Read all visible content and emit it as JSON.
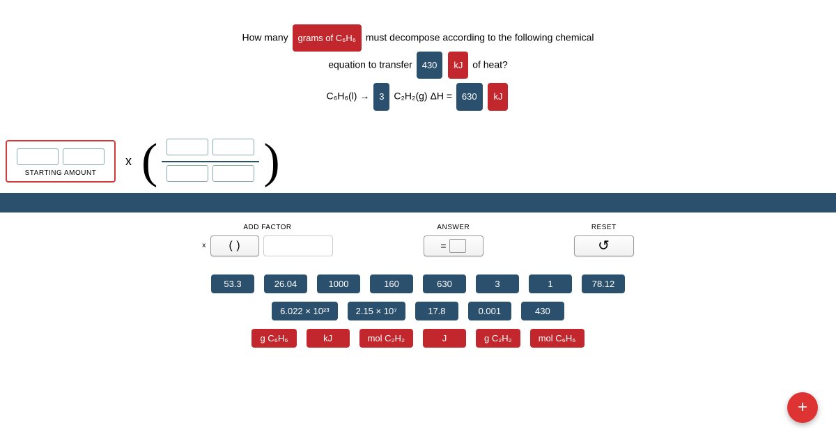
{
  "question": {
    "p1a": "How many",
    "chip_grams": "grams of C₆H₆",
    "p1b": "must decompose according to the following chemical",
    "p2a": "equation to transfer",
    "chip_430": "430",
    "chip_kJ1": "kJ",
    "p2b": "of heat?",
    "eq_lhs": "C₆H₆(l) →",
    "chip_3": "3",
    "eq_mid": "C₂H₂(g) ΔH =",
    "chip_630": "630",
    "chip_kJ2": "kJ"
  },
  "work": {
    "start_label": "STARTING AMOUNT",
    "times": "x"
  },
  "controls": {
    "add_label": "ADD FACTOR",
    "add_times": "x",
    "add_paren": "(   )",
    "answer_label": "ANSWER",
    "answer_eq": "=",
    "reset_label": "RESET",
    "reset_icon": "↺"
  },
  "tiles": {
    "row1": [
      "53.3",
      "26.04",
      "1000",
      "160",
      "630",
      "3",
      "1",
      "78.12"
    ],
    "row2": [
      "6.022 × 10²³",
      "2.15 × 10⁷",
      "17.8",
      "0.001",
      "430"
    ],
    "row3": [
      "g C₆H₆",
      "kJ",
      "mol C₂H₂",
      "J",
      "g C₂H₂",
      "mol C₆H₆"
    ]
  },
  "fab": "+"
}
